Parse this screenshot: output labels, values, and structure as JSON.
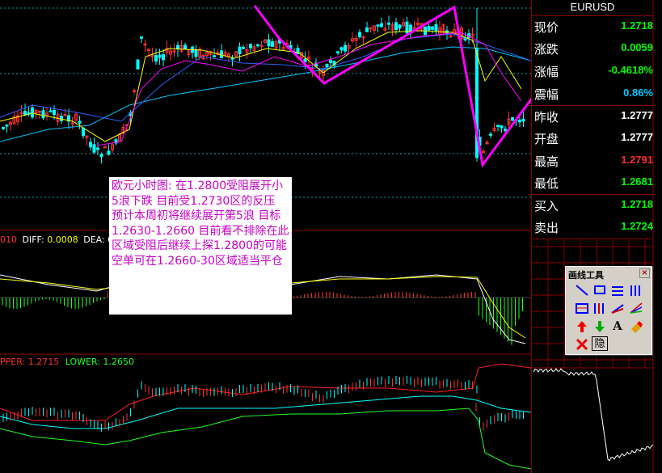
{
  "symbol": "EURUSD",
  "quotes": [
    {
      "key": "current",
      "label": "现价",
      "value": "1.2718",
      "color": "#00ff00"
    },
    {
      "key": "change",
      "label": "涨跌",
      "value": "0.0059",
      "color": "#00ff00"
    },
    {
      "key": "change_pct",
      "label": "涨幅",
      "value": "-0.4618%",
      "color": "#00ff00"
    },
    {
      "key": "amplitude",
      "label": "震幅",
      "value": "0.86%",
      "color": "#00c8ff"
    },
    {
      "key": "prev_close",
      "label": "昨收",
      "value": "1.2777",
      "color": "#ffffff"
    },
    {
      "key": "open",
      "label": "开盘",
      "value": "1.2777",
      "color": "#ffffff"
    },
    {
      "key": "high",
      "label": "最高",
      "value": "1.2791",
      "color": "#ff3030"
    },
    {
      "key": "low",
      "label": "最低",
      "value": "1.2681",
      "color": "#00ff00"
    },
    {
      "key": "bid",
      "label": "买入",
      "value": "1.2718",
      "color": "#00ff00"
    },
    {
      "key": "ask",
      "label": "卖出",
      "value": "1.2724",
      "color": "#00ff00"
    }
  ],
  "macd": {
    "prefix": "010",
    "diff_label": "DIFF: ",
    "diff_value": "0.0008",
    "dea_label": "DEA: 0"
  },
  "boll": {
    "upper_label": "PPER: ",
    "upper_value": "1.2715",
    "lower_label": "LOWER: ",
    "lower_value": "1.2650"
  },
  "annotation": "欧元小时图: 在1.2800受阻展开小5浪下跌 目前受1.2730区的反压 预计本周初将继续展开第5浪 目标1.2630-1.2660  目前看不排除在此区域受阻后继续上探1.2800的可能 空单可在1.2660-30区域适当平仓",
  "toolbox": {
    "title": "画线工具",
    "close": "×",
    "tools": [
      "line",
      "rectangle",
      "parallel-lines",
      "fibonacci-fan",
      "text-tool-1",
      "price-channel",
      "speed-lines",
      "gann-fan",
      "up-arrow",
      "down-arrow",
      "text",
      "eraser",
      "delete",
      "hide"
    ],
    "text_glyph": "A",
    "hide_label": "隐"
  },
  "colors": {
    "up_candle": "#ff3232",
    "down_candle": "#00ffff",
    "ma_yellow": "#ffff00",
    "ma_magenta": "#ff00ff",
    "ma_blue": "#3060ff",
    "ma_cyan": "#00c8ff",
    "boll_red": "#ff2020",
    "boll_green": "#20ff20",
    "wave_line": "#ff00ff"
  }
}
